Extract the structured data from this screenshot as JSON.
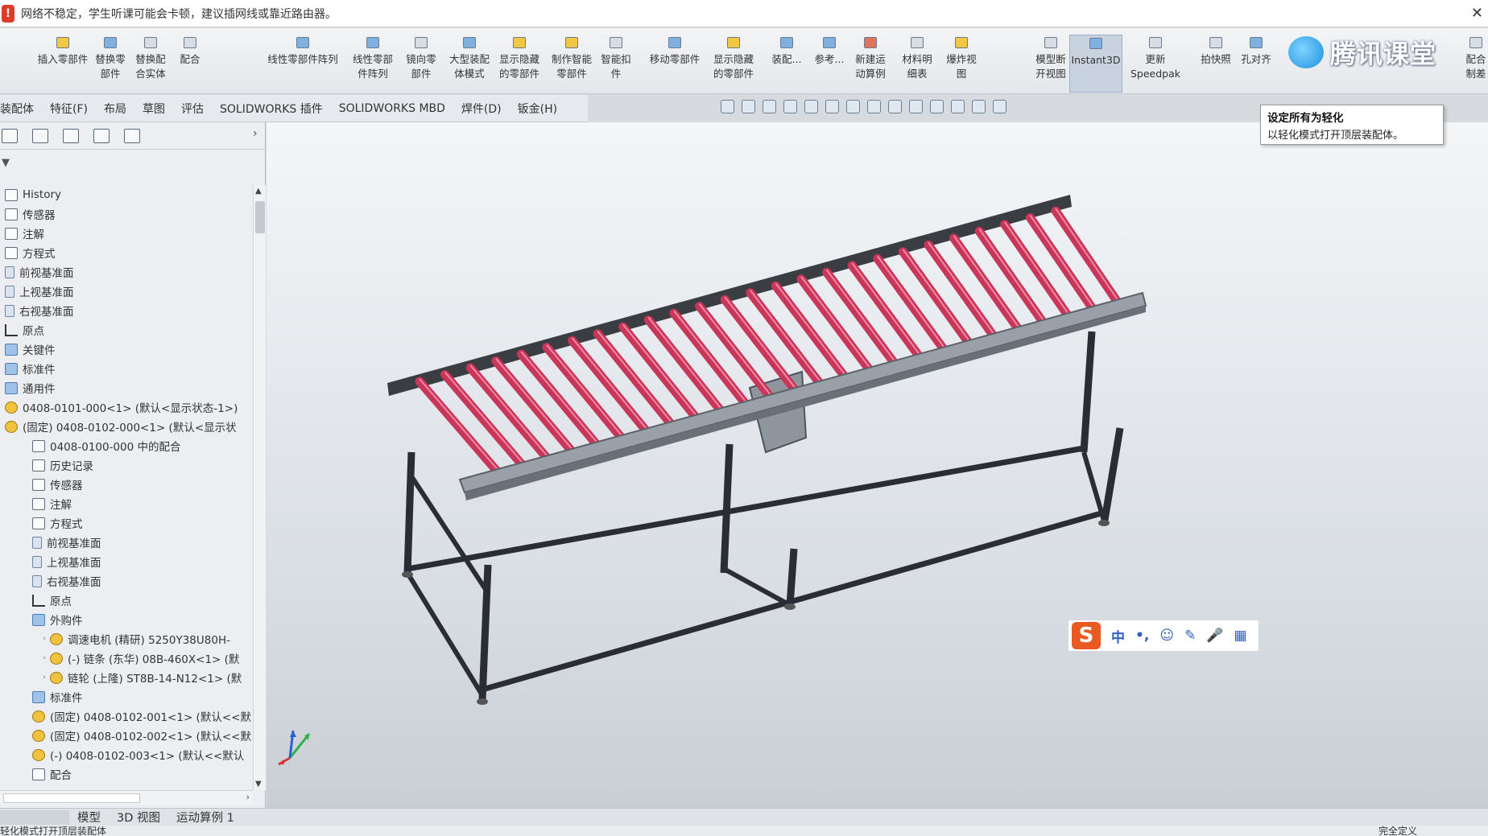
{
  "warning": {
    "icon": "!",
    "text": "网络不稳定，学生听课可能会卡顿，建议插网线或靠近路由器。",
    "close": "✕"
  },
  "ribbon": {
    "buttons": [
      {
        "label": "插入零部件",
        "icon": "insert-component-icon"
      },
      {
        "label": "替换零\n部件",
        "icon": "replace-component-icon"
      },
      {
        "label": "替换配\n合实体",
        "icon": "replace-mate-icon"
      },
      {
        "label": "配合",
        "icon": "mate-icon"
      },
      {
        "label": "线性零部件阵列",
        "icon": "linear-pattern-icon"
      },
      {
        "label": "线性零部\n件阵列",
        "icon": "linear-pattern-icon"
      },
      {
        "label": "镜向零\n部件",
        "icon": "mirror-icon"
      },
      {
        "label": "大型装配\n体模式",
        "icon": "large-assembly-icon"
      },
      {
        "label": "显示隐藏\n的零部件",
        "icon": "show-hidden-icon"
      },
      {
        "label": "制作智能\n零部件",
        "icon": "smart-component-icon"
      },
      {
        "label": "智能扣\n件",
        "icon": "smart-fastener-icon"
      },
      {
        "label": "移动零部件",
        "icon": "move-component-icon"
      },
      {
        "label": "显示隐藏\n的零部件",
        "icon": "show-hidden-icon"
      },
      {
        "label": "装配...",
        "icon": "assembly-feature-icon"
      },
      {
        "label": "参考...",
        "icon": "reference-geometry-icon"
      },
      {
        "label": "新建运\n动算例",
        "icon": "motion-study-icon"
      },
      {
        "label": "材料明\n细表",
        "icon": "bom-icon"
      },
      {
        "label": "爆炸视\n图",
        "icon": "explode-icon"
      },
      {
        "label": "模型断\n开视图",
        "icon": "break-view-icon"
      },
      {
        "label": "Instant3D",
        "icon": "instant3d-icon"
      },
      {
        "label": "更新\nSpeedpak",
        "icon": "speedpak-icon"
      },
      {
        "label": "拍快照",
        "icon": "snapshot-icon"
      },
      {
        "label": "孔对齐",
        "icon": "hole-align-icon"
      },
      {
        "label": "配合\n制差",
        "icon": "mate-tolerance-icon"
      }
    ],
    "brand": "腾讯课堂"
  },
  "tabs": [
    "装配体",
    "特征(F)",
    "布局",
    "草图",
    "评估",
    "SOLIDWORKS 插件",
    "SOLIDWORKS MBD",
    "焊件(D)",
    "钣金(H)"
  ],
  "tooltip": {
    "title": "设定所有为轻化",
    "desc": "以轻化模式打开顶层装配体。"
  },
  "panel": {
    "filter": "▼",
    "chevron": "›",
    "tree": [
      {
        "label": "History",
        "icon": "history",
        "indent": 0
      },
      {
        "label": "传感器",
        "icon": "sensor",
        "indent": 0
      },
      {
        "label": "注解",
        "icon": "annotation",
        "indent": 0
      },
      {
        "label": "方程式",
        "icon": "equation",
        "indent": 0
      },
      {
        "label": "前视基准面",
        "icon": "plane",
        "indent": 0
      },
      {
        "label": "上视基准面",
        "icon": "plane",
        "indent": 0
      },
      {
        "label": "右视基准面",
        "icon": "plane",
        "indent": 0
      },
      {
        "label": "原点",
        "icon": "origin",
        "indent": 0
      },
      {
        "label": "关键件",
        "icon": "folder",
        "indent": 0
      },
      {
        "label": "标准件",
        "icon": "folder",
        "indent": 0
      },
      {
        "label": "通用件",
        "icon": "folder",
        "indent": 0
      },
      {
        "label": "0408-0101-000<1> (默认<显示状态-1>)",
        "icon": "part",
        "indent": 0
      },
      {
        "label": "(固定) 0408-0102-000<1> (默认<显示状",
        "icon": "part",
        "indent": 0
      },
      {
        "label": "0408-0100-000 中的配合",
        "icon": "mate",
        "indent": 1
      },
      {
        "label": "历史记录",
        "icon": "history",
        "indent": 1
      },
      {
        "label": "传感器",
        "icon": "sensor",
        "indent": 1
      },
      {
        "label": "注解",
        "icon": "annotation",
        "indent": 1
      },
      {
        "label": "方程式",
        "icon": "equation",
        "indent": 1
      },
      {
        "label": "前视基准面",
        "icon": "plane",
        "indent": 1
      },
      {
        "label": "上视基准面",
        "icon": "plane",
        "indent": 1
      },
      {
        "label": "右视基准面",
        "icon": "plane",
        "indent": 1
      },
      {
        "label": "原点",
        "icon": "origin",
        "indent": 1
      },
      {
        "label": "外购件",
        "icon": "folder",
        "indent": 1
      },
      {
        "label": "调速电机 (精研) 5250Y38U80H-",
        "icon": "part",
        "indent": 2
      },
      {
        "label": "(-) 链条 (东华) 08B-460X<1> (默",
        "icon": "part",
        "indent": 2
      },
      {
        "label": "链轮 (上隆) ST8B-14-N12<1> (默",
        "icon": "part",
        "indent": 2
      },
      {
        "label": "标准件",
        "icon": "folder",
        "indent": 1
      },
      {
        "label": "(固定) 0408-0102-001<1> (默认<<默",
        "icon": "part",
        "indent": 1
      },
      {
        "label": "(固定) 0408-0102-002<1> (默认<<默",
        "icon": "part",
        "indent": 1
      },
      {
        "label": "(-) 0408-0102-003<1> (默认<<默认",
        "icon": "part",
        "indent": 1
      },
      {
        "label": "配合",
        "icon": "mate",
        "indent": 1
      }
    ]
  },
  "ime": {
    "logo": "S",
    "items": [
      "中",
      "•,",
      "☺",
      "✎",
      "🎤",
      "▦"
    ]
  },
  "bottom_tabs": [
    "模型",
    "3D 视图",
    "运动算例 1"
  ],
  "status": {
    "left": "轻化模式打开顶层装配体",
    "right": "完全定义"
  },
  "colors": {
    "roller": "#c8365a",
    "frame": "#2a2d33",
    "rail": "#9aa0a8"
  }
}
